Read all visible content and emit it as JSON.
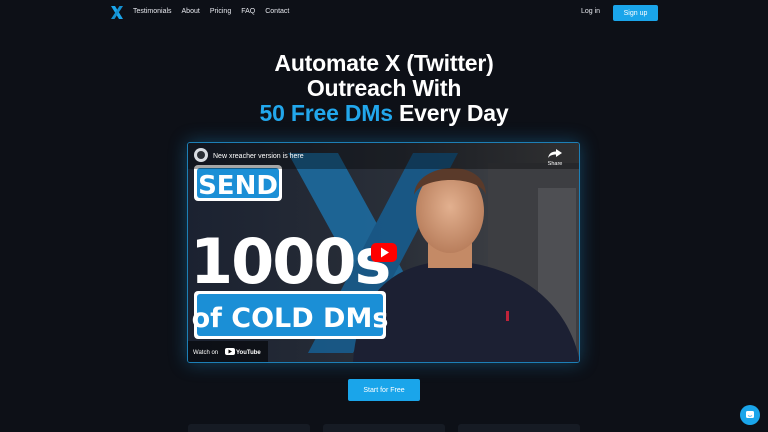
{
  "nav": {
    "links": [
      "Testimonials",
      "About",
      "Pricing",
      "FAQ",
      "Contact"
    ],
    "login_label": "Log in",
    "signup_label": "Sign up"
  },
  "hero": {
    "line1": "Automate X (Twitter)",
    "line2": "Outreach With",
    "line3_accent": "50 Free DMs",
    "line3_rest": " Every Day"
  },
  "video": {
    "title": "New xreacher version is here",
    "share_label": "Share",
    "watch_on": "Watch on",
    "youtube_label": "YouTube",
    "thumb_text": {
      "send": "SEND",
      "count": "1000s",
      "cold": "of COLD DMs"
    }
  },
  "cta": {
    "start_label": "Start for Free"
  },
  "icons": {
    "logo": "x-logo-icon",
    "play": "play-icon",
    "share": "share-arrow-icon",
    "chat": "chat-icon"
  },
  "colors": {
    "background": "#0d1017",
    "accent": "#22a7ec",
    "button": "#1aa5ea",
    "youtube_red": "#ff0000"
  }
}
